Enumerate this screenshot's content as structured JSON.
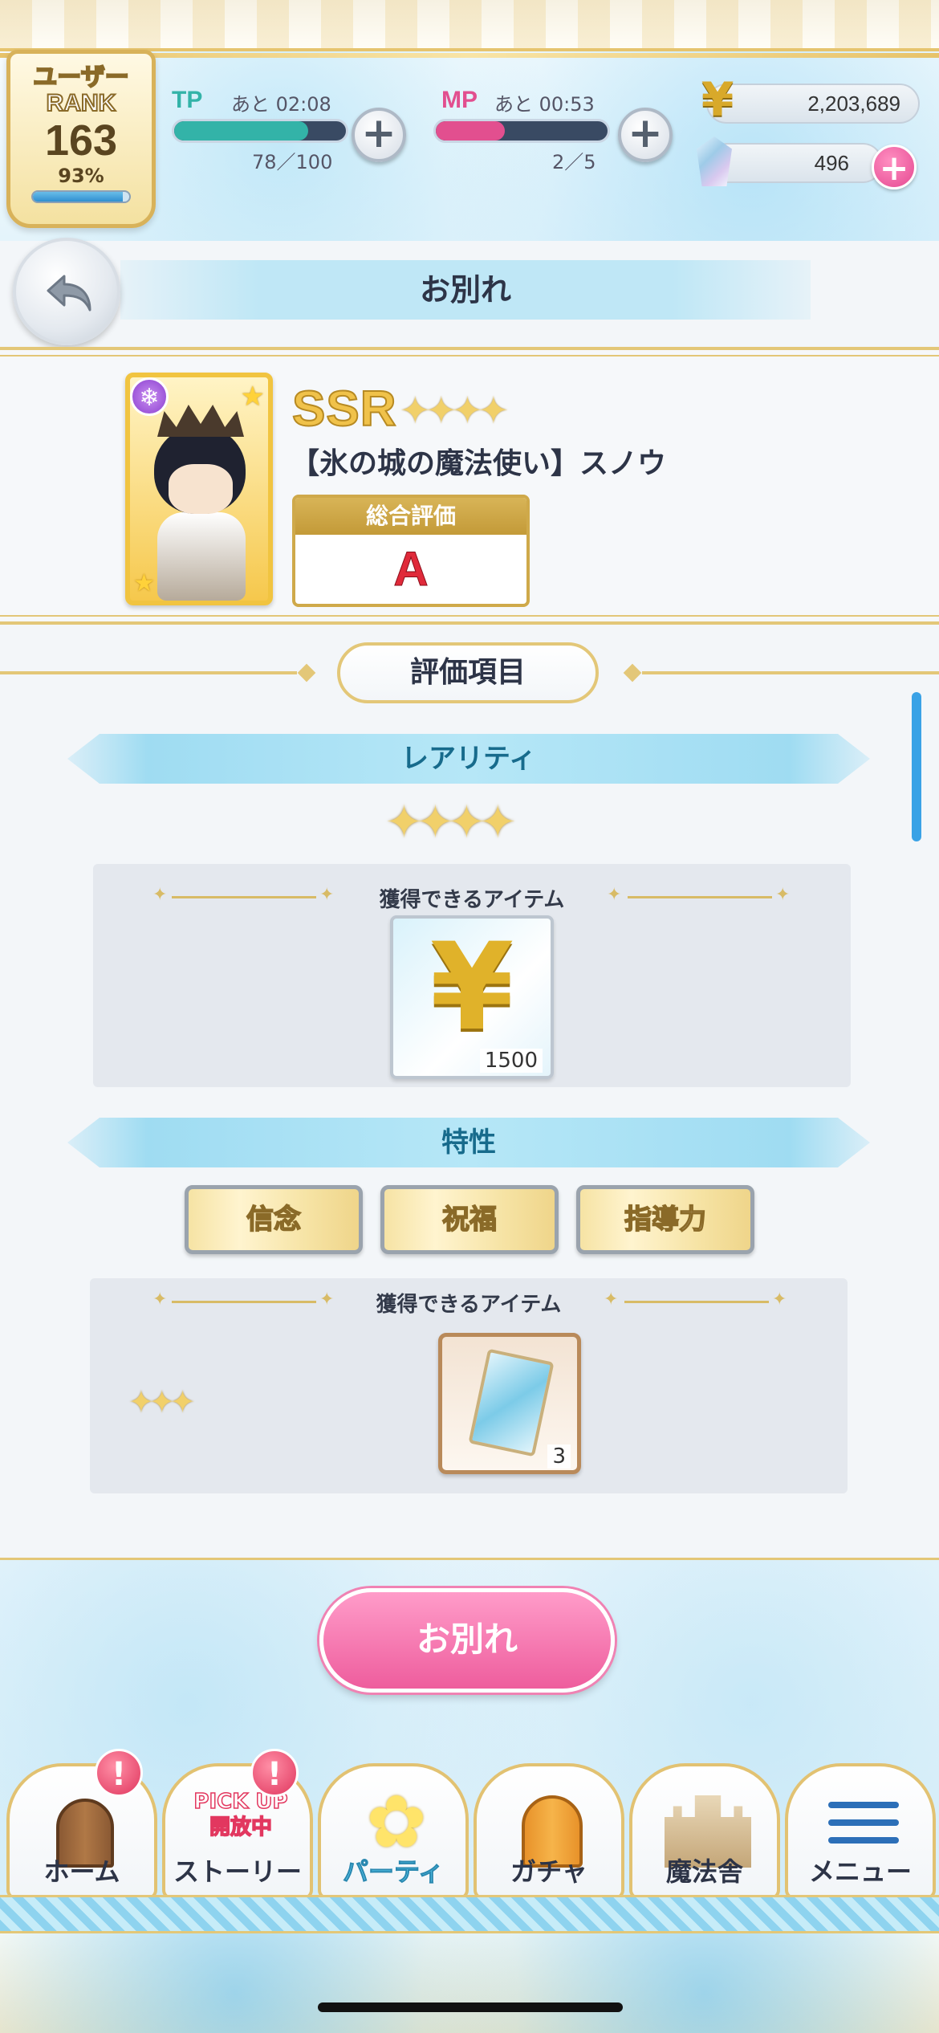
{
  "header": {
    "rank_label": "ユーザー\nRANK",
    "rank_value": "163",
    "rank_percent": "93%",
    "rank_progress": 0.93,
    "tp": {
      "label": "TP",
      "time": "あと 02:08",
      "count": "78／100",
      "progress": 0.78,
      "color": "#33b3a8"
    },
    "mp": {
      "label": "MP",
      "time": "あと 00:53",
      "count": "2／5",
      "progress": 0.4,
      "color": "#e24f8f"
    },
    "gold": "2,203,689",
    "gems": "496",
    "plus_symbol": "+"
  },
  "title_bar": {
    "title": "お別れ"
  },
  "character": {
    "rarity": "SSR",
    "rarity_stars": "✦✦✦✦",
    "name": "【氷の城の魔法使い】スノウ",
    "overall_label": "総合評価",
    "overall_grade": "A",
    "attribute_icon": "snowflake-icon"
  },
  "evaluation": {
    "heading": "評価項目",
    "rarity_section": {
      "title": "レアリティ",
      "stars": "✦✦✦✦",
      "items_label": "獲得できるアイテム",
      "reward_icon": "yen-icon",
      "reward_count": "1500"
    },
    "traits_section": {
      "title": "特性",
      "traits": [
        "信念",
        "祝福",
        "指導力"
      ],
      "items_label": "獲得できるアイテム",
      "reward_stars": "✦✦✦",
      "reward_icon": "card-icon",
      "reward_count": "3"
    }
  },
  "action": {
    "farewell_label": "お別れ"
  },
  "nav": {
    "items": [
      {
        "label": "ホーム",
        "alert": "!"
      },
      {
        "label": "ストーリー",
        "alert": "!",
        "badge": "PICK UP\n開放中"
      },
      {
        "label": "パーティ",
        "active": true
      },
      {
        "label": "ガチャ"
      },
      {
        "label": "魔法舎"
      },
      {
        "label": "メニュー"
      }
    ]
  },
  "colors": {
    "gold_accent": "#e3c778",
    "pink_button": "#ee5d9d",
    "grade_red": "#e02a3a",
    "sky_blue": "#9fdcf2"
  }
}
